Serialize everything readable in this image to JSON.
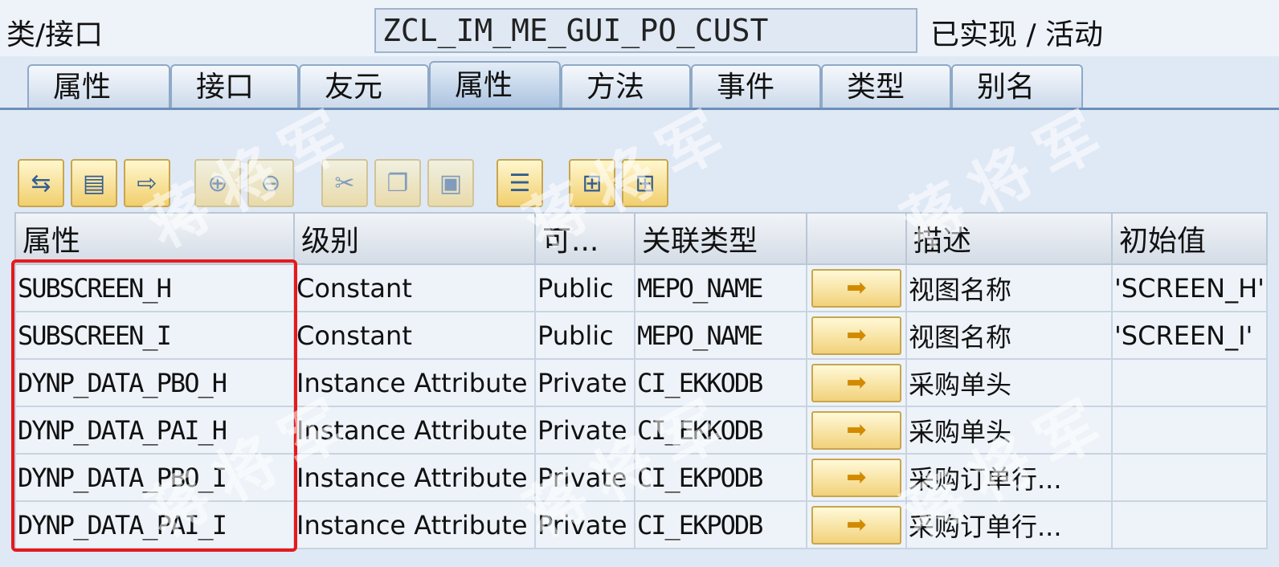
{
  "header": {
    "class_label": "类/接口",
    "class_name": "ZCL_IM_ME_GUI_PO_CUST",
    "status": "已实现 / 活动"
  },
  "tabs": [
    {
      "label": "属性",
      "active": false
    },
    {
      "label": "接口",
      "active": false
    },
    {
      "label": "友元",
      "active": false
    },
    {
      "label": "属性",
      "active": true
    },
    {
      "label": "方法",
      "active": false
    },
    {
      "label": "事件",
      "active": false
    },
    {
      "label": "类型",
      "active": false
    },
    {
      "label": "别名",
      "active": false
    }
  ],
  "toolbar": {
    "icons": [
      "navigate-icon",
      "detail-view-icon",
      "move-icon",
      "insert-row-icon",
      "delete-row-icon",
      "cut-icon",
      "copy-icon",
      "paste-icon",
      "layers-icon",
      "find-icon",
      "find-next-icon"
    ]
  },
  "table": {
    "headers": [
      "属性",
      "级别",
      "可...",
      "关联类型",
      "",
      "描述",
      "初始值"
    ],
    "rows": [
      {
        "attribute": "SUBSCREEN_H",
        "level": "Constant",
        "visibility": "Public",
        "assoc_type": "MEPO_NAME",
        "description": "视图名称",
        "initial": "'SCREEN_H'"
      },
      {
        "attribute": "SUBSCREEN_I",
        "level": "Constant",
        "visibility": "Public",
        "assoc_type": "MEPO_NAME",
        "description": "视图名称",
        "initial": "'SCREEN_I'"
      },
      {
        "attribute": "DYNP_DATA_PBO_H",
        "level": "Instance Attribute",
        "visibility": "Private",
        "assoc_type": "CI_EKKODB",
        "description": "采购单头",
        "initial": ""
      },
      {
        "attribute": "DYNP_DATA_PAI_H",
        "level": "Instance Attribute",
        "visibility": "Private",
        "assoc_type": "CI_EKKODB",
        "description": "采购单头",
        "initial": ""
      },
      {
        "attribute": "DYNP_DATA_PBO_I",
        "level": "Instance Attribute",
        "visibility": "Private",
        "assoc_type": "CI_EKPODB",
        "description": "采购订单行...",
        "initial": ""
      },
      {
        "attribute": "DYNP_DATA_PAI_I",
        "level": "Instance Attribute",
        "visibility": "Private",
        "assoc_type": "CI_EKPODB",
        "description": "采购订单行...",
        "initial": ""
      }
    ]
  },
  "watermark": "蒋将军",
  "colors": {
    "highlight": "#e6191c",
    "tab_active": "#a9c2df",
    "button": "#f2d27a"
  }
}
